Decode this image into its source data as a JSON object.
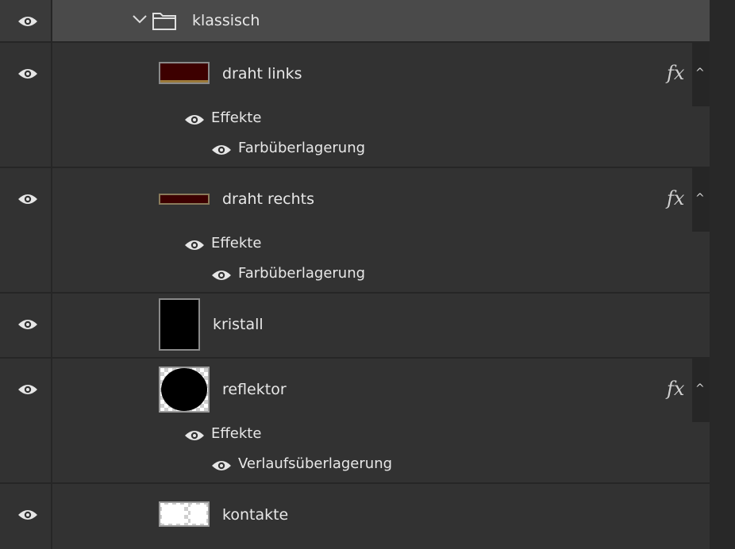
{
  "group": {
    "name": "klassisch"
  },
  "layers": [
    {
      "name": "draht links",
      "fx": "fx",
      "effects_label": "Effekte",
      "effects": [
        "Farbüberlagerung"
      ]
    },
    {
      "name": "draht rechts",
      "fx": "fx",
      "effects_label": "Effekte",
      "effects": [
        "Farbüberlagerung"
      ]
    },
    {
      "name": "kristall"
    },
    {
      "name": "reflektor",
      "fx": "fx",
      "effects_label": "Effekte",
      "effects": [
        "Verlaufsüberlagerung"
      ]
    },
    {
      "name": "kontakte"
    }
  ],
  "icons": {
    "visibility": "eye-icon",
    "folder": "folder-icon",
    "expand": "chevron-down-icon",
    "collapse": "chevron-up-icon",
    "effects": "fx-icon"
  },
  "colors": {
    "panel_bg": "#323232",
    "group_row_bg": "#4a4a4a",
    "wire_thumb": "#3d0000",
    "wire_thumb_border": "#9b7a3a"
  }
}
